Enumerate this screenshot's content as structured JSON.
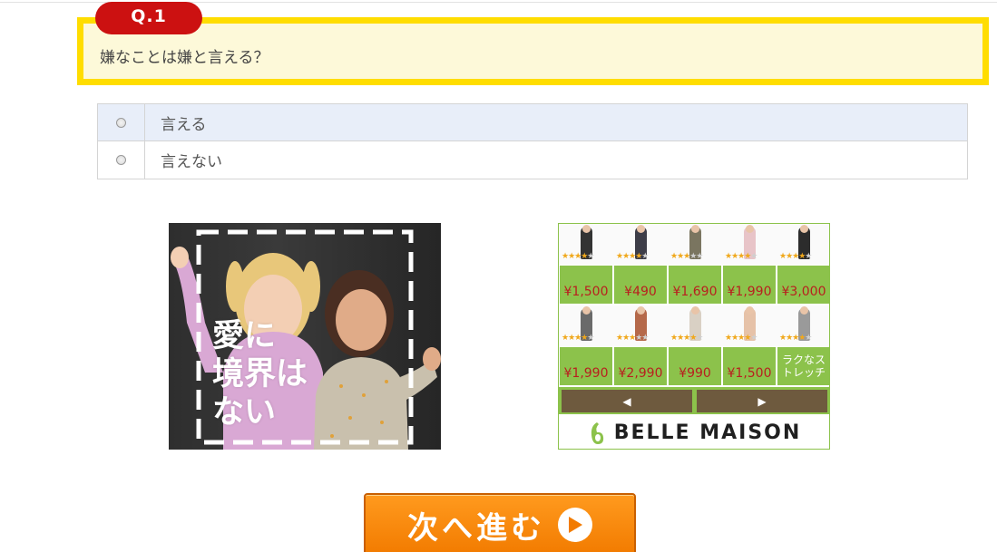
{
  "question": {
    "number_label": "Q.1",
    "text": "嫌なことは嫌と言える？"
  },
  "options": [
    {
      "label": "言える",
      "highlighted": true
    },
    {
      "label": "言えない",
      "highlighted": false
    }
  ],
  "ad_photo": {
    "copy_lines": [
      "愛に",
      "境界は",
      "ない"
    ]
  },
  "ad_shop": {
    "adchoices_icon": "adchoices-icon",
    "row1": [
      {
        "price": "¥1,500",
        "stars": 4
      },
      {
        "price": "¥490",
        "stars": 4
      },
      {
        "price": "¥1,690",
        "stars": 3
      },
      {
        "price": "¥1,990",
        "stars": 4
      },
      {
        "price": "¥3,000",
        "stars": 4
      }
    ],
    "row2": [
      {
        "price": "¥1,990",
        "stars": 4
      },
      {
        "price": "¥2,990",
        "stars": 3
      },
      {
        "price": "¥990",
        "stars": 4
      },
      {
        "price": "¥1,500",
        "stars": 4
      },
      {
        "price": "ラクなストレッチ",
        "stars": 4
      }
    ],
    "prev_glyph": "◀",
    "next_glyph": "▶",
    "brand": "BELLE MAISON",
    "accent": "#8cc24b"
  },
  "next_button": {
    "label": "次へ進む",
    "icon": "play-arrow-icon",
    "color": "#f5870a"
  }
}
